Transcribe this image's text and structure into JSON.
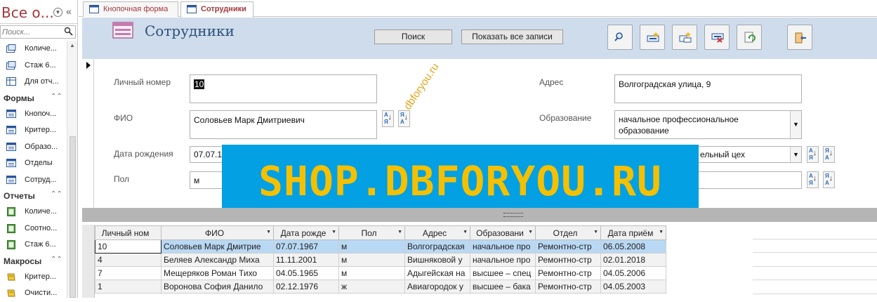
{
  "nav": {
    "title": "Все о...",
    "search_placeholder": "Поиск...",
    "items": [
      {
        "label": "Количе...",
        "kind": "query"
      },
      {
        "label": "Стаж 6...",
        "kind": "query"
      },
      {
        "label": "Для отч...",
        "kind": "query"
      }
    ],
    "groups": [
      {
        "label": "Формы",
        "items": [
          {
            "label": "Кнопоч...",
            "kind": "form"
          },
          {
            "label": "Критер...",
            "kind": "form"
          },
          {
            "label": "Образо...",
            "kind": "form"
          },
          {
            "label": "Отделы",
            "kind": "form"
          },
          {
            "label": "Сотруд...",
            "kind": "form"
          }
        ]
      },
      {
        "label": "Отчеты",
        "items": [
          {
            "label": "Количе...",
            "kind": "report"
          },
          {
            "label": "Соотно...",
            "kind": "report"
          },
          {
            "label": "Стаж 6...",
            "kind": "report"
          }
        ]
      },
      {
        "label": "Макросы",
        "items": [
          {
            "label": "Критер...",
            "kind": "macro"
          },
          {
            "label": "Очисти...",
            "kind": "macro"
          }
        ]
      }
    ]
  },
  "tabs": [
    {
      "label": "Кнопочная форма",
      "active": false
    },
    {
      "label": "Сотрудники",
      "active": true
    }
  ],
  "header": {
    "title": "Сотрудники",
    "search_button": "Поиск",
    "show_all_button": "Показать все записи"
  },
  "fields": {
    "personal_number_label": "Личный номер",
    "personal_number_value": "10",
    "fio_label": "ФИО",
    "fio_value": "Соловьев Марк Дмитриевич",
    "birth_label": "Дата рождения",
    "birth_value": "07.07.1",
    "gender_label": "Пол",
    "gender_value": "м",
    "address_label": "Адрес",
    "address_value": "Волгоградская улица, 9",
    "education_label": "Образование",
    "education_value": "начальное профессиональное образование",
    "department_value": "ельный цех"
  },
  "watermark": {
    "banner": "SHOP.DBFORYOU.RU",
    "diagonal": "dbforyou.ru"
  },
  "table": {
    "columns": [
      "Личный ном",
      "ФИО",
      "Дата рожде",
      "Пол",
      "Адрес",
      "Образовани",
      "Отдел",
      "Дата приём"
    ],
    "rows": [
      [
        "10",
        "Соловьев Марк Дмитрие",
        "07.07.1967",
        "м",
        "Волгоградская",
        "начальное про",
        "Ремонтно-стр",
        "06.05.2008"
      ],
      [
        "4",
        "Беляев Александр Миха",
        "11.11.2001",
        "м",
        "Вишняковой у",
        "начальное про",
        "Ремонтно-стр",
        "02.01.2018"
      ],
      [
        "7",
        "Мещеряков Роман Тихо",
        "04.05.1965",
        "м",
        "Адыгейская на",
        "высшее – спец",
        "Ремонтно-стр",
        "04.05.2006"
      ],
      [
        "1",
        "Воронова София Данило",
        "02.12.1976",
        "ж",
        "Авиагородок у",
        "высшее – бака",
        "Ремонтно-стр",
        "04.05.2003"
      ]
    ]
  }
}
